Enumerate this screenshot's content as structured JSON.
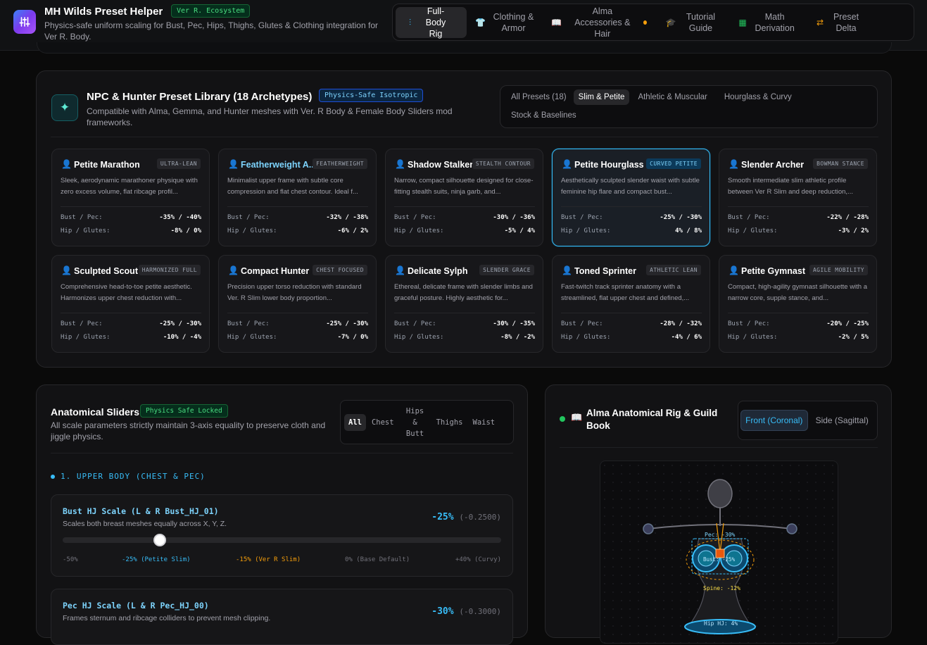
{
  "app": {
    "title": "MH Wilds Preset Helper",
    "badge": "Ver R. Ecosystem",
    "subtitle": "Physics-safe uniform scaling for Bust, Pec, Hips, Thighs, Glutes & Clothing integration for Ver R. Body."
  },
  "nav": {
    "tabs": [
      {
        "label": "Full-Body Rig",
        "icon": "sliders-icon",
        "active": true
      },
      {
        "label": "Clothing & Armor",
        "icon": "shirt-icon"
      },
      {
        "label": "Alma Accessories & Hair",
        "icon": "book-icon",
        "dot": true
      },
      {
        "label": "Tutorial Guide",
        "icon": "graduation-cap-icon"
      },
      {
        "label": "Math Derivation",
        "icon": "calculator-icon"
      },
      {
        "label": "Preset Delta",
        "icon": "git-compare-icon"
      }
    ]
  },
  "library": {
    "title": "NPC & Hunter Preset Library (18 Archetypes)",
    "badge": "Physics-Safe Isotropic",
    "subtitle": "Compatible with Alma, Gemma, and Hunter meshes with Ver. R Body & Female Body Sliders mod frameworks.",
    "filters": [
      "All Presets (18)",
      "Slim & Petite",
      "Athletic & Muscular",
      "Hourglass & Curvy",
      "Stock & Baselines"
    ],
    "active_filter": "Slim & Petite",
    "bust_label": "Bust / Pec:",
    "hip_label": "Hip / Glutes:",
    "presets": [
      {
        "name": "Petite Marathon",
        "tag": "ULTRA-LEAN",
        "desc": "Sleek, aerodynamic marathoner physique with zero excess volume, flat ribcage profil...",
        "bust": "-35% / -40%",
        "hip": "-8% / 0%"
      },
      {
        "name": "Featherweight A...",
        "tag": "FEATHERWEIGHT",
        "desc": "Minimalist upper frame with subtle core compression and flat chest contour. Ideal f...",
        "bust": "-32% / -38%",
        "hip": "-6% / 2%"
      },
      {
        "name": "Shadow Stalker",
        "tag": "STEALTH CONTOUR",
        "desc": "Narrow, compact silhouette designed for close-fitting stealth suits, ninja garb, and...",
        "bust": "-30% / -36%",
        "hip": "-5% / 4%"
      },
      {
        "name": "Petite Hourglass",
        "tag": "CURVED PETITE",
        "desc": "Aesthetically sculpted slender waist with subtle feminine hip flare and compact bust...",
        "bust": "-25% / -30%",
        "hip": "4% / 8%",
        "selected": true
      },
      {
        "name": "Slender Archer",
        "tag": "BOWMAN STANCE",
        "desc": "Smooth intermediate slim athletic profile between Ver R Slim and deep reduction,...",
        "bust": "-22% / -28%",
        "hip": "-3% / 2%"
      },
      {
        "name": "Sculpted Scout",
        "tag": "HARMONIZED FULL",
        "desc": "Comprehensive head-to-toe petite aesthetic. Harmonizes upper chest reduction with...",
        "bust": "-25% / -30%",
        "hip": "-10% / -4%"
      },
      {
        "name": "Compact Hunter",
        "tag": "CHEST FOCUSED",
        "desc": "Precision upper torso reduction with standard Ver. R Slim lower body proportion...",
        "bust": "-25% / -30%",
        "hip": "-7% / 0%"
      },
      {
        "name": "Delicate Sylph",
        "tag": "SLENDER GRACE",
        "desc": "Ethereal, delicate frame with slender limbs and graceful posture. Highly aesthetic for...",
        "bust": "-30% / -35%",
        "hip": "-8% / -2%"
      },
      {
        "name": "Toned Sprinter",
        "tag": "ATHLETIC LEAN",
        "desc": "Fast-twitch track sprinter anatomy with a streamlined, flat upper chest and defined,...",
        "bust": "-28% / -32%",
        "hip": "-4% / 6%"
      },
      {
        "name": "Petite Gymnast",
        "tag": "AGILE MOBILITY",
        "desc": "Compact, high-agility gymnast silhouette with a narrow core, supple stance, and...",
        "bust": "-20% / -25%",
        "hip": "-2% / 5%"
      }
    ]
  },
  "sliders": {
    "title": "Anatomical Sliders",
    "badge": "Physics Safe Locked",
    "subtitle": "All scale parameters strictly maintain 3-axis equality to preserve cloth and jiggle physics.",
    "segments": [
      "All",
      "Chest",
      "Hips & Butt",
      "Thighs",
      "Waist"
    ],
    "active_segment": "All",
    "section": "1. UPPER BODY (CHEST & PEC)",
    "items": [
      {
        "name": "Bust HJ Scale (L & R Bust_HJ_01)",
        "desc": "Scales both breast meshes equally across X, Y, Z.",
        "value": "-25%",
        "raw": "(-0.2500)",
        "fraction": 0.2222,
        "marks": [
          {
            "label": "-50%"
          },
          {
            "label": "-25% (Petite Slim)",
            "color": "#38bdf8"
          },
          {
            "label": "-15% (Ver R Slim)",
            "color": "#f59e0b"
          },
          {
            "label": "0% (Base Default)"
          },
          {
            "label": "+40% (Curvy)"
          }
        ]
      },
      {
        "name": "Pec HJ Scale (L & R Pec_HJ_00)",
        "desc": "Frames sternum and ribcage colliders to prevent mesh clipping.",
        "value": "-30%",
        "raw": "(-0.3000)"
      }
    ]
  },
  "rig": {
    "title": "Alma Anatomical Rig & Guild Book",
    "views": [
      "Front (Coronal)",
      "Side (Sagittal)"
    ],
    "active_view": "Front (Coronal)",
    "labels": {
      "pec": "Pec: -30%",
      "bust": "Bust: -25%",
      "spine": "Spine: -12%",
      "hip": "Hip HJ: 4%"
    },
    "colors": {
      "accent": "#38bdf8",
      "warn": "#f59e0b",
      "ok": "#22c55e"
    }
  }
}
